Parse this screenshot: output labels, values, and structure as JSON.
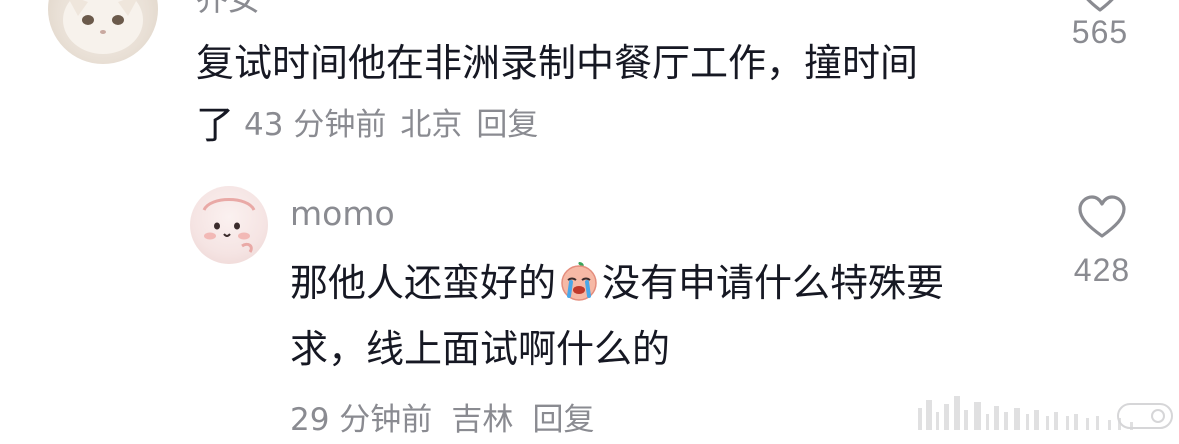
{
  "comments": [
    {
      "username": "乔女",
      "text_line1": "复试时间他在非洲录制中餐厅工作，撞时间",
      "text_tail": "了",
      "time_ago": "43 分钟前",
      "location": "北京",
      "reply_label": "回复",
      "like_count": "565",
      "avatar_icon": "cat-avatar"
    },
    {
      "username": "momo",
      "text_part1": "那他人还蛮好的",
      "emoji": "crying-face-emoji",
      "text_part2": "没有申请什么特殊要",
      "text_line2": "求，线上面试啊什么的",
      "time_ago": "29 分钟前",
      "location": "吉林",
      "reply_label": "回复",
      "like_count": "428",
      "avatar_icon": "pink-character-avatar"
    }
  ],
  "colors": {
    "primary_text": "#161823",
    "secondary_text": "#8a8b91",
    "background": "#ffffff"
  }
}
